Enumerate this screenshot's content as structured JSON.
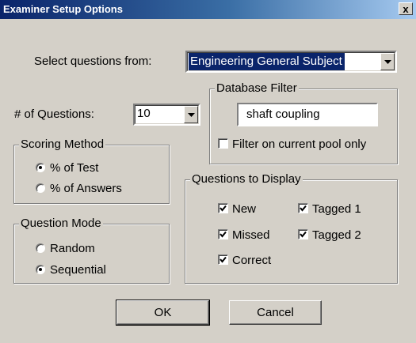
{
  "window": {
    "title": "Examiner Setup Options",
    "close_glyph": "x"
  },
  "select_questions": {
    "label": "Select questions from:",
    "value": "Engineering General Subject"
  },
  "num_questions": {
    "label": "# of Questions:",
    "value": "10"
  },
  "database_filter": {
    "title": "Database Filter",
    "value": "shaft coupling",
    "pool_only_label": "Filter on current pool only",
    "pool_only_checked": false
  },
  "scoring_method": {
    "title": "Scoring Method",
    "options": [
      {
        "label": "% of Test",
        "selected": true
      },
      {
        "label": "% of Answers",
        "selected": false
      }
    ]
  },
  "question_mode": {
    "title": "Question Mode",
    "options": [
      {
        "label": "Random",
        "selected": false
      },
      {
        "label": "Sequential",
        "selected": true
      }
    ]
  },
  "questions_to_display": {
    "title": "Questions to Display",
    "items": [
      {
        "label": "New",
        "checked": true
      },
      {
        "label": "Tagged 1",
        "checked": true
      },
      {
        "label": "Missed",
        "checked": true
      },
      {
        "label": "Tagged 2",
        "checked": true
      },
      {
        "label": "Correct",
        "checked": true
      }
    ]
  },
  "buttons": {
    "ok": "OK",
    "cancel": "Cancel"
  }
}
